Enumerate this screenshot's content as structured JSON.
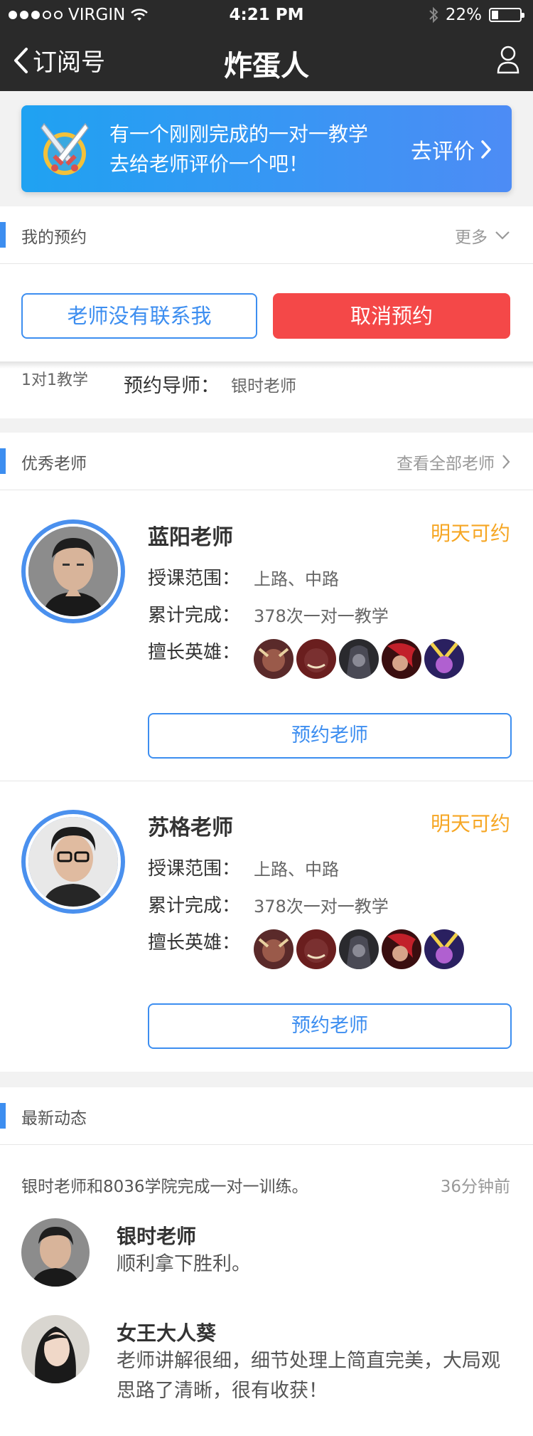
{
  "status_bar": {
    "carrier": "VIRGIN",
    "time": "4:21 PM",
    "battery": "22%",
    "battery_level": 0.22
  },
  "nav": {
    "back_label": "订阅号",
    "title": "炸蛋人"
  },
  "banner": {
    "line1": "有一个刚刚完成的一对一教学",
    "line2": "去给老师评价一个吧！",
    "action": "去评价"
  },
  "my_booking": {
    "title": "我的预约",
    "more": "更多",
    "no_contact_btn": "老师没有联系我",
    "cancel_btn": "取消预约",
    "type": "1对1教学",
    "mentor_label": "预约导师：",
    "mentor_name": "银时老师"
  },
  "teachers_section": {
    "title": "优秀老师",
    "view_all": "查看全部老师"
  },
  "teachers": [
    {
      "name": "蓝阳老师",
      "status": "明天可约",
      "scope_label": "授课范围：",
      "scope": "上路、中路",
      "done_label": "累计完成：",
      "done": "378次一对一教学",
      "heroes_label": "擅长英雄：",
      "book_btn": "预约老师"
    },
    {
      "name": "苏格老师",
      "status": "明天可约",
      "scope_label": "授课范围：",
      "scope": "上路、中路",
      "done_label": "累计完成：",
      "done": "378次一对一教学",
      "heroes_label": "擅长英雄：",
      "book_btn": "预约老师"
    }
  ],
  "news": {
    "title": "最新动态",
    "event": "银时老师和8036学院完成一对一训练。",
    "time": "36分钟前",
    "items": [
      {
        "name": "银时老师",
        "text": "顺利拿下胜利。"
      },
      {
        "name": "女王大人葵",
        "text": "老师讲解很细，细节处理上简直完美，大局观思路了清晰，很有收获！"
      }
    ]
  },
  "colors": {
    "accent": "#3d8ef0",
    "danger": "#f44848",
    "available": "#f6a623",
    "nav_bg": "#2a2a2a"
  }
}
